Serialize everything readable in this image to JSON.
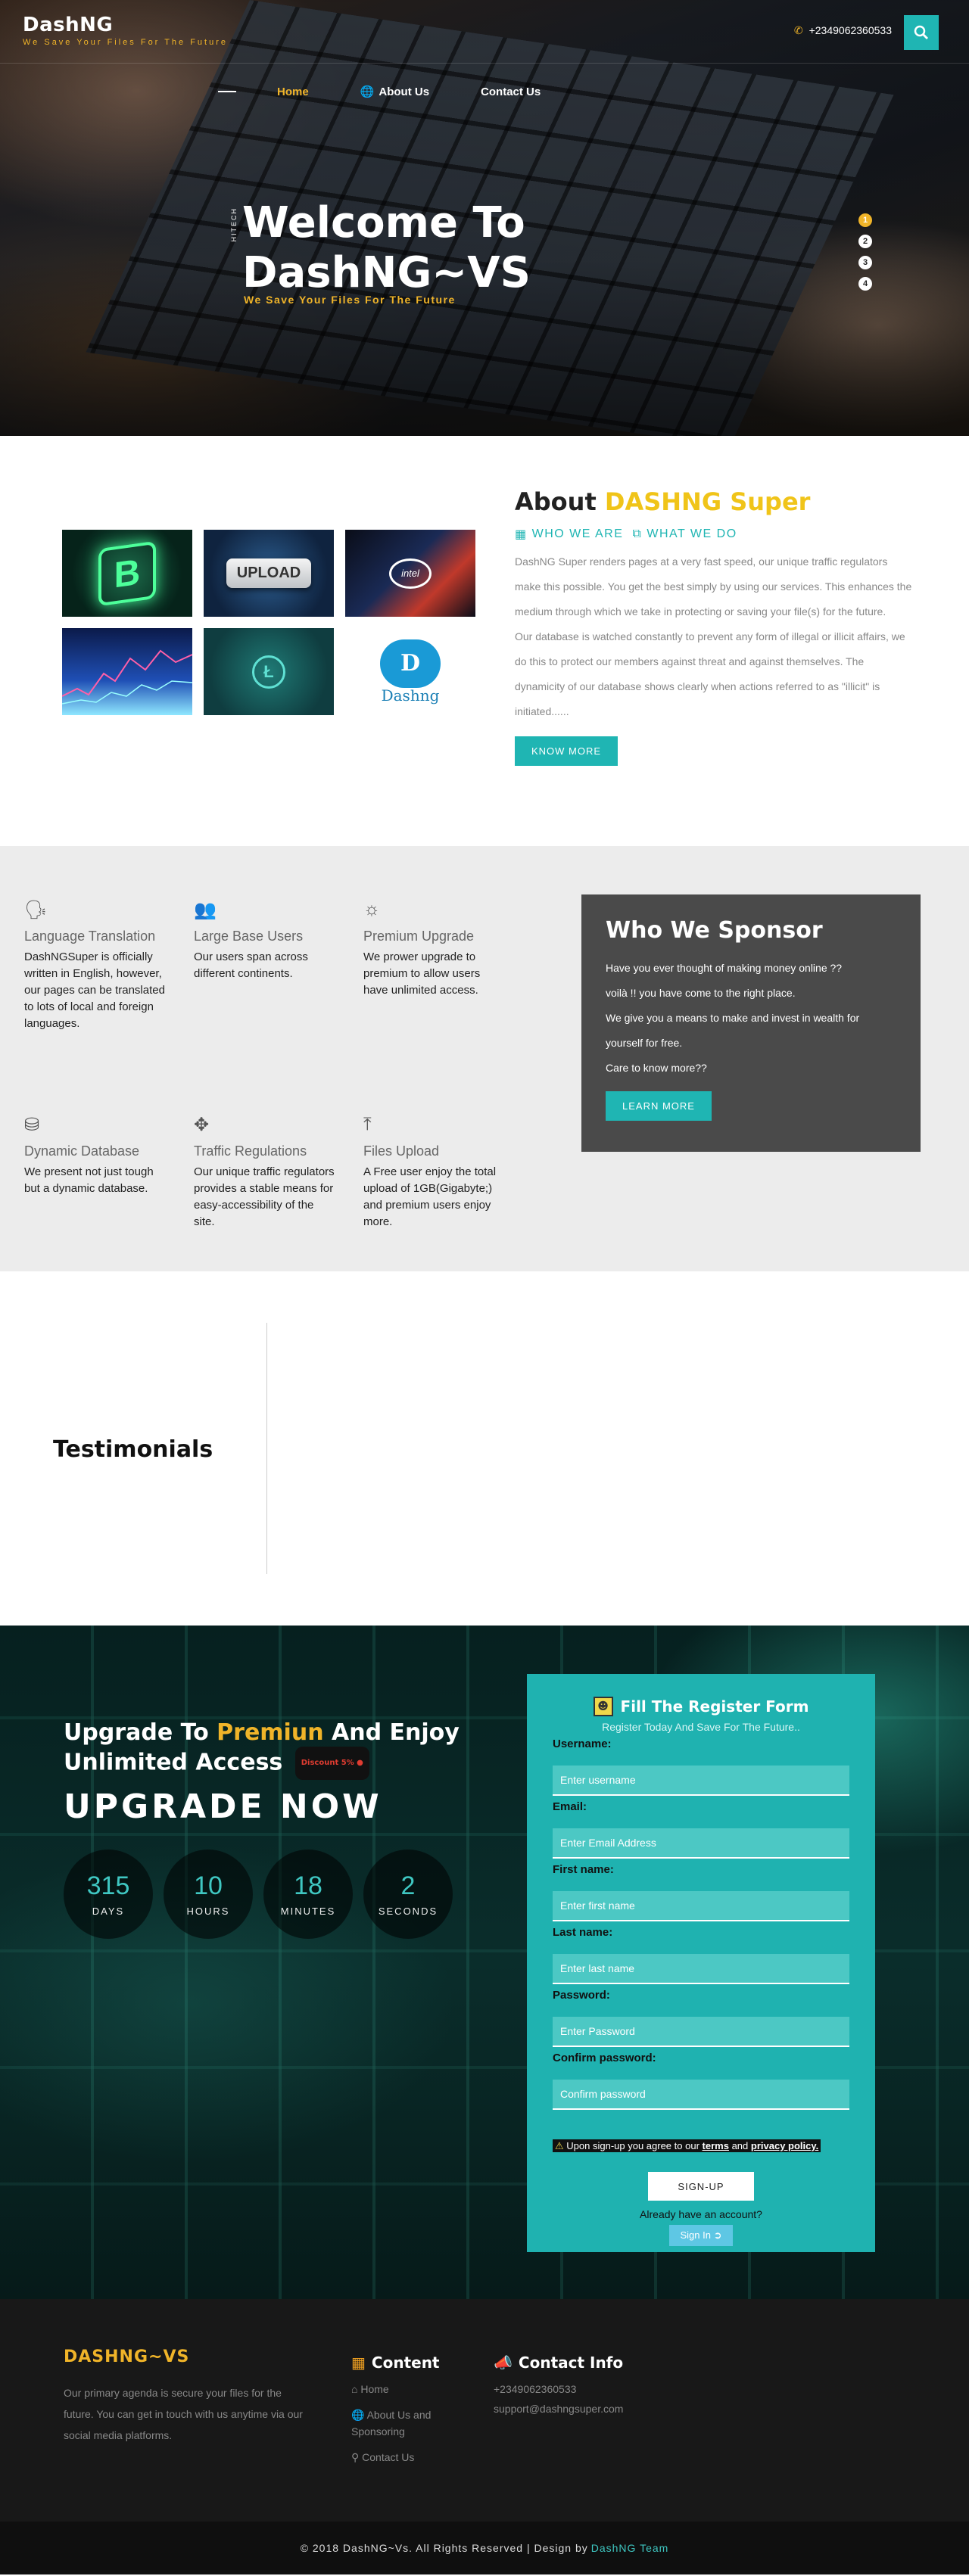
{
  "header": {
    "brand": "DashNG",
    "tagline": "We Save Your Files For The Future",
    "phone": "+2349062360533",
    "nav": [
      {
        "label": "Home"
      },
      {
        "label": "About Us"
      },
      {
        "label": "Contact Us"
      }
    ]
  },
  "hero": {
    "side_label": "HITECH",
    "title_line1": "Welcome To",
    "title_line2": "DashNG~VS",
    "subtitle": "We Save Your Files For The Future",
    "slides": [
      "1",
      "2",
      "3",
      "4"
    ],
    "active_slide": "1"
  },
  "about": {
    "title_prefix": "About",
    "title_accent": "DASHNG Super",
    "link_who": "WHO WE ARE",
    "link_what": "WHAT WE DO",
    "paragraph1": "DashNG Super renders pages at a very fast speed, our unique traffic regulators make this possible. You get the best simply by using our services. This enhances the medium through which we take in protecting or saving your file(s) for the future.",
    "paragraph2": "Our database is watched constantly to prevent any form of illegal or illicit affairs, we do this to protect our members against threat and against themselves. The dynamicity of our database shows clearly when actions referred to as \"illicit\" is initiated......",
    "button": "KNOW MORE",
    "gallery": {
      "upload_label": "UPLOAD",
      "intel_label": "intel",
      "litecoin_label": "Ł",
      "bitcoin_label": "B",
      "badge_letter": "D",
      "badge_text": "Dashng"
    }
  },
  "features": [
    {
      "icon": "language-icon",
      "title": "Language Translation",
      "text": "DashNGSuper is officially written in English, however, our pages can be translated to lots of local and foreign languages."
    },
    {
      "icon": "users-icon",
      "title": "Large Base Users",
      "text": "Our users span across different continents."
    },
    {
      "icon": "lifebuoy-icon",
      "title": "Premium Upgrade",
      "text": "We prower upgrade to premium to allow users have unlimited access."
    },
    {
      "icon": "database-icon",
      "title": "Dynamic Database",
      "text": "We present not just tough but a dynamic database."
    },
    {
      "icon": "move-arrows-icon",
      "title": "Traffic Regulations",
      "text": "Our unique traffic regulators provides a stable means for easy-accessibility of the site."
    },
    {
      "icon": "upload-icon",
      "title": "Files Upload",
      "text": "A Free user enjoy the total upload of 1GB(Gigabyte;) and premium users enjoy more."
    }
  ],
  "sponsor": {
    "title": "Who We Sponsor",
    "line1": "Have you ever thought of making money online ??",
    "line2": "voilà !! you have come to the right place.",
    "line3": "We give you a means to make and invest in wealth for yourself for free.",
    "line4": "Care to know more??",
    "button": "LEARN MORE"
  },
  "testimonials": {
    "title": "Testimonials"
  },
  "upgrade": {
    "head_prefix": "Upgrade To",
    "head_accent": "Premiun",
    "head_suffix": "And Enjoy",
    "head_line2": "Unlimited Access",
    "discount": "Discount 5% ●",
    "cta": "UPGRADE NOW",
    "counters": [
      {
        "value": "315",
        "label": "DAYS"
      },
      {
        "value": "10",
        "label": "HOURS"
      },
      {
        "value": "18",
        "label": "MINUTES"
      },
      {
        "value": "2",
        "label": "SECONDS"
      }
    ]
  },
  "register": {
    "title": "Fill The Register Form",
    "subtitle": "Register Today And Save For The Future..",
    "fields": [
      {
        "label": "Username:",
        "placeholder": "Enter username"
      },
      {
        "label": "Email:",
        "placeholder": "Enter Email Address"
      },
      {
        "label": "First name:",
        "placeholder": "Enter first name"
      },
      {
        "label": "Last name:",
        "placeholder": "Enter last name"
      },
      {
        "label": "Password:",
        "placeholder": "Enter Password"
      },
      {
        "label": "Confirm password:",
        "placeholder": "Confirm password"
      }
    ],
    "agree_prefix": "Upon sign-up you agree to our",
    "terms": "terms",
    "and": "and",
    "privacy": "privacy policy.",
    "signup": "SIGN-UP",
    "have_account": "Already have an account?",
    "signin": "Sign In"
  },
  "footer": {
    "brand": "DASHNG~VS",
    "about": "Our primary agenda is secure your files for the future. You can get in touch with us anytime via our social media platforms.",
    "content_title": "Content",
    "content_links": [
      "Home",
      "About Us and Sponsoring",
      "Contact Us"
    ],
    "contact_title": "Contact Info",
    "contact_phone": "+2349062360533",
    "contact_email": "support@dashngsuper.com",
    "copyright": "© 2018 DashNG~Vs. All Rights Reserved | Design by",
    "team": "DashNG Team"
  },
  "colors": {
    "teal": "#1fb5b3",
    "gold": "#f0b429",
    "dark": "#181818"
  }
}
